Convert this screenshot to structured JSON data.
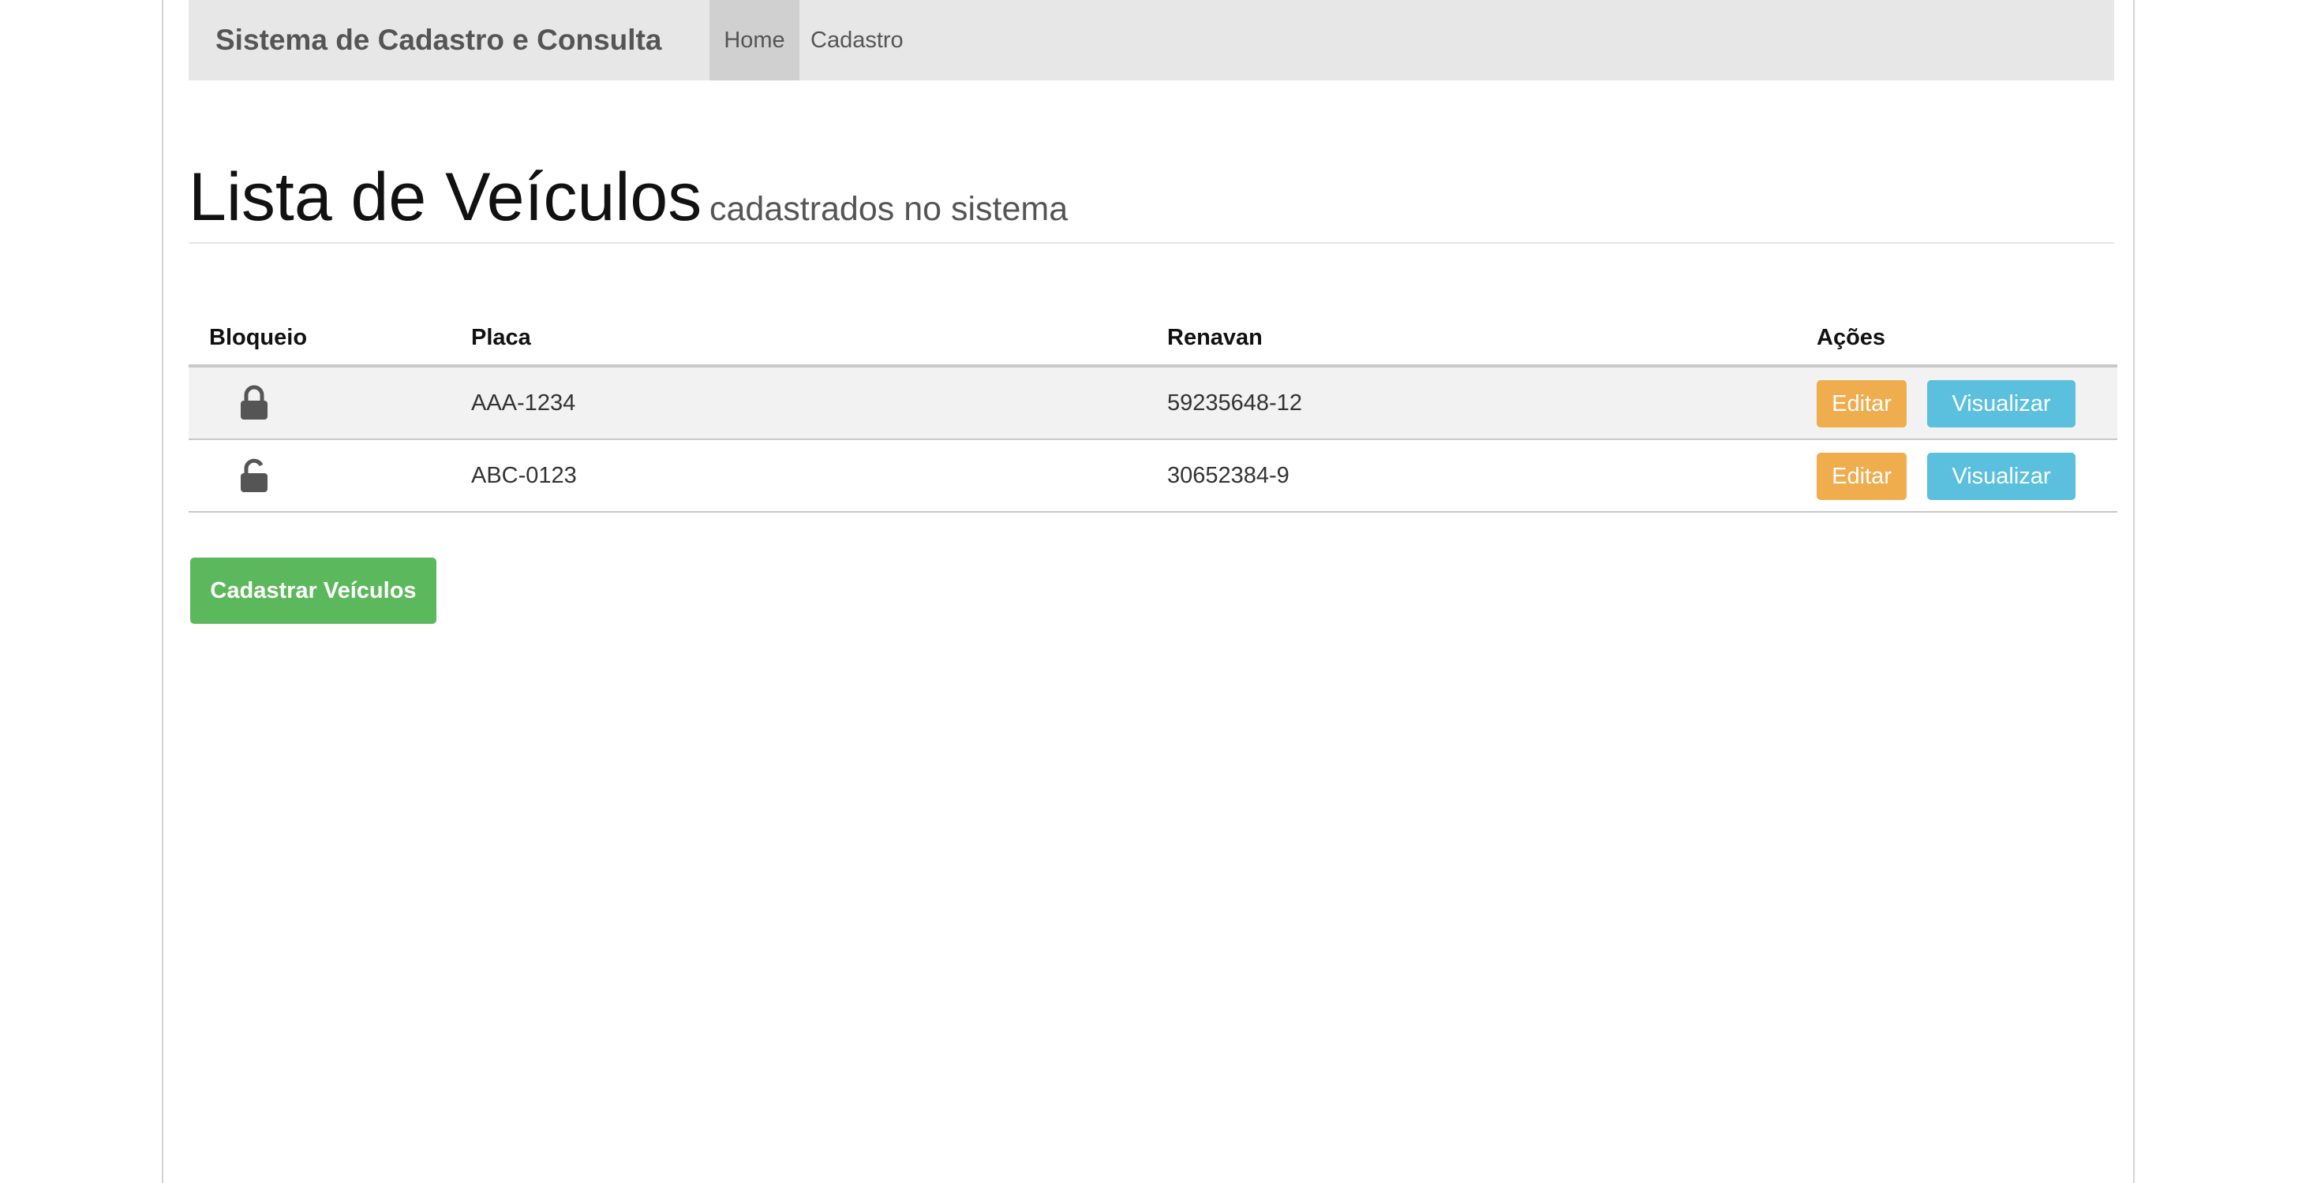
{
  "navbar": {
    "brand": "Sistema de Cadastro e Consulta",
    "items": [
      {
        "label": "Home",
        "active": true
      },
      {
        "label": "Cadastro",
        "active": false
      }
    ]
  },
  "page": {
    "title": "Lista de Veículos",
    "subtitle": "cadastrados no sistema"
  },
  "table": {
    "headers": {
      "bloqueio": "Bloqueio",
      "placa": "Placa",
      "renavan": "Renavan",
      "acoes": "Ações"
    },
    "rows": [
      {
        "locked": true,
        "lock_icon": "lock-closed-icon",
        "placa": "AAA-1234",
        "renavan": "59235648-12",
        "edit_label": "Editar",
        "view_label": "Visualizar"
      },
      {
        "locked": false,
        "lock_icon": "lock-open-icon",
        "placa": "ABC-0123",
        "renavan": "30652384-9",
        "edit_label": "Editar",
        "view_label": "Visualizar"
      }
    ]
  },
  "actions": {
    "add_label": "Cadastrar Veículos"
  },
  "colors": {
    "navbar_bg": "#e7e7e7",
    "edit": "#f0ad4e",
    "view": "#5bc0de",
    "add": "#5cb85c"
  }
}
